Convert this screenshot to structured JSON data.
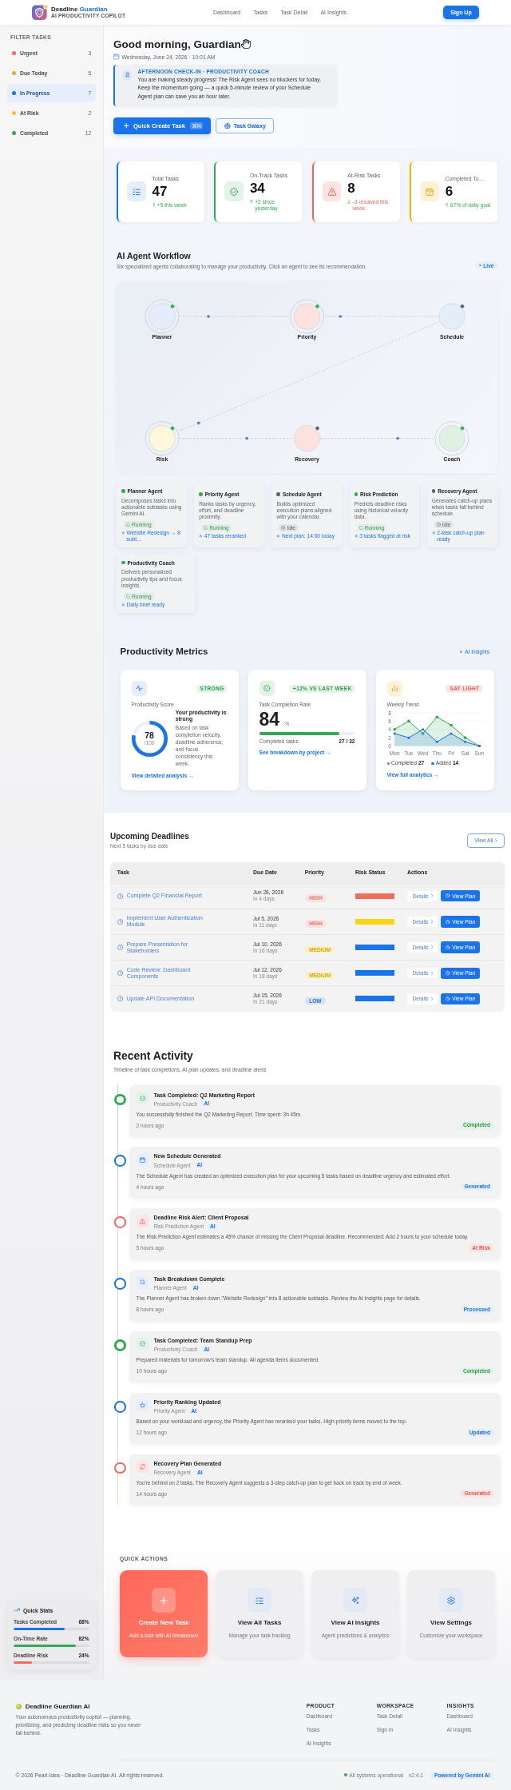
{
  "header": {
    "brand": "Deadline",
    "brand_accent": "Guardian",
    "tagline": "AI PRODUCTIVITY COPILOT",
    "nav": [
      "Dashboard",
      "Tasks",
      "Task Detail",
      "AI Insights"
    ],
    "signup": "Sign Up"
  },
  "sidebar": {
    "title": "FILTER TASKS",
    "filters": [
      {
        "label": "Urgent",
        "count": "3",
        "color": "#ef6b5e",
        "selected": false
      },
      {
        "label": "Due Today",
        "count": "5",
        "color": "#f5a524",
        "selected": false
      },
      {
        "label": "In Progress",
        "count": "7",
        "color": "#1a73e8",
        "selected": true
      },
      {
        "label": "At Risk",
        "count": "2",
        "color": "#f6c21c",
        "selected": false
      },
      {
        "label": "Completed",
        "count": "12",
        "color": "#34a853",
        "selected": false
      }
    ],
    "quick_stats": {
      "title": "Quick Stats",
      "items": [
        {
          "label": "Tasks Completed",
          "reading": "68%",
          "level": 0.68,
          "color": "#1a73e8"
        },
        {
          "label": "On-Time Rate",
          "reading": "82%",
          "level": 0.82,
          "color": "#34a853"
        },
        {
          "label": "Deadline Risk",
          "reading": "24%",
          "level": 0.24,
          "color": "#ef6b5e"
        }
      ]
    }
  },
  "greeting": {
    "title": "Good morning, Guardian",
    "date": "Wednesday, June 24, 2026 · 10:01 AM"
  },
  "coach": {
    "title": "AFTERNOON CHECK-IN · PRODUCTIVITY COACH",
    "text": "You are making steady progress! The Risk Agent sees no blockers for today. Keep the momentum going — a quick 5-minute review of your Schedule Agent plan can save you an hour later."
  },
  "hero_actions": [
    {
      "kind": "primary",
      "label": "Quick Create Task",
      "shortcut": "⌘N"
    },
    {
      "kind": "outline",
      "label": "Task Galaxy"
    }
  ],
  "stats": [
    {
      "kind": "total",
      "label": "Total Tasks",
      "value": "47",
      "trend": "+5 this week",
      "rising": true
    },
    {
      "kind": "on_track",
      "label": "On-Track Tasks",
      "value": "34",
      "trend": "+2 since yesterday",
      "rising": true
    },
    {
      "kind": "at_risk",
      "label": "At-Risk Tasks",
      "value": "8",
      "trend": "-3 resolved this week",
      "rising": false
    },
    {
      "kind": "completed",
      "label": "Completed To…",
      "value": "6",
      "trend": "67% of daily goal",
      "rising": true
    }
  ],
  "workflow": {
    "title": "AI Agent Workflow",
    "subtitle": "Six specialized agents collaborating to manage your productivity. Click an agent to see its recommendation.",
    "live": "Live",
    "nodes": [
      {
        "label": "Planner",
        "color": "#e6edfa",
        "running": true
      },
      {
        "label": "Priority",
        "color": "#fce2df",
        "running": true
      },
      {
        "label": "Schedule",
        "color": "#e6edfa",
        "running": false
      },
      {
        "label": "Risk",
        "color": "#fdf8dc",
        "running": true
      },
      {
        "label": "Recovery",
        "color": "#fce2df",
        "running": false
      },
      {
        "label": "Coach",
        "color": "#dff1e3",
        "running": true
      }
    ],
    "agents": [
      {
        "name": "Planner Agent",
        "description": "Decomposes tasks into actionable subtasks using Gemini AI.",
        "running": true,
        "status": "Running",
        "output": "Website Redesign → 8 subt…"
      },
      {
        "name": "Priority Agent",
        "description": "Ranks tasks by urgency, effort, and deadline proximity.",
        "running": true,
        "status": "Running",
        "output": "47 tasks reranked"
      },
      {
        "name": "Schedule Agent",
        "description": "Builds optimized execution plans aligned with your calendar.",
        "running": false,
        "status": "Idle",
        "output": "Next plan: 14:00 today"
      },
      {
        "name": "Risk Prediction",
        "description": "Predicts deadline risks using historical velocity data.",
        "running": true,
        "status": "Running",
        "output": "3 tasks flagged at risk"
      },
      {
        "name": "Recovery Agent",
        "description": "Generates catch-up plans when tasks fall behind schedule.",
        "running": false,
        "status": "Idle",
        "output": "2-task catch-up plan ready"
      },
      {
        "name": "Productivity Coach",
        "description": "Delivers personalized productivity tips and focus insights.",
        "running": true,
        "status": "Running",
        "output": "Daily brief ready"
      }
    ]
  },
  "metrics": {
    "title": "Productivity Metrics",
    "link": "AI Insights",
    "cards": [
      {
        "kind": "score",
        "badge": "STRONG",
        "positive": true,
        "label": "Productivity Score",
        "value": "78",
        "max": "/100",
        "level": 0.78,
        "headline": "Your productivity is strong",
        "text": "Based on task completion velocity, deadline adherence, and focus consistency this week.",
        "link": "View detailed analysis →"
      },
      {
        "kind": "rate",
        "badge": "+12% VS LAST WEEK",
        "positive": true,
        "label": "Task Completion Rate",
        "value": "84",
        "unit": "%",
        "level": 0.84,
        "caption": "Completed tasks",
        "reading": "27 / 32",
        "link": "See breakdown by project →"
      },
      {
        "kind": "trend",
        "badge": "SAT LIGHT",
        "positive": false,
        "label": "Weekly Trend",
        "chart_data": {
          "type": "area",
          "categories": [
            "Mon",
            "Tue",
            "Wed",
            "Thu",
            "Fri",
            "Sat",
            "Sun"
          ],
          "ylim": [
            0,
            8
          ],
          "yticks": [
            0,
            2,
            4,
            6,
            8
          ],
          "grid": true,
          "series": [
            {
              "name": "Completed",
              "color": "#34a853",
              "values": [
                4,
                6,
                3,
                7,
                5,
                2,
                0
              ]
            },
            {
              "name": "Added",
              "color": "#1a73e8",
              "values": [
                3,
                2,
                4,
                1,
                3,
                1,
                0
              ]
            }
          ]
        },
        "totals": [
          "27",
          "14"
        ],
        "link": "View full analytics →"
      }
    ]
  },
  "deadlines": {
    "title": "Upcoming Deadlines",
    "subtitle": "Next 5 tasks by due date",
    "view_all": "View All",
    "columns": [
      "Task",
      "Due Date",
      "Priority",
      "Risk Status",
      "Actions"
    ],
    "rows": [
      {
        "task": "Complete Q2 Financial Report",
        "due": "Jun 28, 2026",
        "relative": "In 4 days",
        "priority": {
          "label": "HIGH",
          "kind": "high"
        },
        "risk": {
          "color": "#f26b5b"
        },
        "details": "Details",
        "plan": "View Plan"
      },
      {
        "task": "Implement User Authentication Module",
        "due": "Jul 5, 2026",
        "relative": "In 11 days",
        "priority": {
          "label": "HIGH",
          "kind": "high"
        },
        "risk": {
          "color": "#fdd314"
        },
        "details": "Details",
        "plan": "View Plan"
      },
      {
        "task": "Prepare Presentation for Stakeholders",
        "due": "Jul 10, 2026",
        "relative": "In 16 days",
        "priority": {
          "label": "MEDIUM",
          "kind": "medium"
        },
        "risk": {
          "color": "#1a73e8"
        },
        "details": "Details",
        "plan": "View Plan"
      },
      {
        "task": "Code Review: Dashboard Components",
        "due": "Jul 12, 2026",
        "relative": "In 18 days",
        "priority": {
          "label": "MEDIUM",
          "kind": "medium"
        },
        "risk": {
          "color": "#1a73e8"
        },
        "details": "Details",
        "plan": "View Plan"
      },
      {
        "task": "Update API Documentation",
        "due": "Jul 15, 2026",
        "relative": "In 21 days",
        "priority": {
          "label": "LOW",
          "kind": "low"
        },
        "risk": {
          "color": "#1a73e8"
        },
        "details": "Details",
        "plan": "View Plan"
      }
    ]
  },
  "activity": {
    "title": "Recent Activity",
    "subtitle": "Timeline of task completions, AI plan updates, and deadline alerts",
    "items": [
      {
        "kind": "completed",
        "title": "Task Completed: Q2 Marketing Report",
        "agent": "Productivity Coach",
        "ai": "AI",
        "text": "You successfully finished the Q2 Marketing Report. Time spent: 3h 45m.",
        "time": "2 hours ago",
        "status": "Completed"
      },
      {
        "kind": "schedule",
        "title": "New Schedule Generated",
        "agent": "Schedule Agent",
        "ai": "AI",
        "text": "The Schedule Agent has created an optimized execution plan for your upcoming 5 tasks based on deadline urgency and estimated effort.",
        "time": "4 hours ago",
        "status": "Generated"
      },
      {
        "kind": "risk",
        "title": "Deadline Risk Alert: Client Proposal",
        "agent": "Risk Prediction Agent",
        "ai": "AI",
        "text": "The Risk Prediction Agent estimates a 45% chance of missing the Client Proposal deadline. Recommended: Add 2 hours to your schedule today.",
        "time": "5 hours ago",
        "status": "At Risk"
      },
      {
        "kind": "breakdown",
        "title": "Task Breakdown Complete",
        "agent": "Planner Agent",
        "ai": "AI",
        "text": "The Planner Agent has broken down \"Website Redesign\" into 8 actionable subtasks. Review the AI Insights page for details.",
        "time": "8 hours ago",
        "status": "Processed"
      },
      {
        "kind": "completed",
        "title": "Task Completed: Team Standup Prep",
        "agent": "Productivity Coach",
        "ai": "AI",
        "text": "Prepared materials for tomorrow's team standup. All agenda items documented.",
        "time": "10 hours ago",
        "status": "Completed"
      },
      {
        "kind": "priority",
        "title": "Priority Ranking Updated",
        "agent": "Priority Agent",
        "ai": "AI",
        "text": "Based on your workload and urgency, the Priority Agent has reranked your tasks. High-priority items moved to the top.",
        "time": "12 hours ago",
        "status": "Updated"
      },
      {
        "kind": "recovery",
        "title": "Recovery Plan Generated",
        "agent": "Recovery Agent",
        "ai": "AI",
        "text": "You're behind on 2 tasks. The Recovery Agent suggests a 3-step catch-up plan to get back on track by end of week.",
        "time": "14 hours ago",
        "status": "Generated"
      }
    ]
  },
  "quick_actions": {
    "title": "QUICK ACTIONS",
    "items": [
      {
        "kind": "create",
        "title": "Create New Task",
        "text": "Add a task with AI breakdown"
      },
      {
        "kind": "tasks",
        "title": "View All Tasks",
        "text": "Manage your task backlog"
      },
      {
        "kind": "insights",
        "title": "View AI Insights",
        "text": "Agent predictions & analytics"
      },
      {
        "kind": "settings",
        "title": "View Settings",
        "text": "Customize your workspace"
      }
    ]
  },
  "footer": {
    "brand": "Deadline Guardian AI",
    "text": "Your autonomous productivity copilot — planning, prioritizing, and predicting deadline risks so you never fall behind.",
    "columns": [
      {
        "title": "PRODUCT",
        "links": [
          "Dashboard",
          "Tasks",
          "AI Insights"
        ]
      },
      {
        "title": "WORKSPACE",
        "links": [
          "Task Detail",
          "Sign In"
        ]
      },
      {
        "title": "INSIGHTS",
        "links": [
          "Dashboard",
          "AI Insights"
        ]
      }
    ],
    "copyright": "© 2026 Pearl-Idea · Deadline Guardian AI. All rights reserved.",
    "status": "All systems operational",
    "version": "v2.4.1",
    "powered": "Powered by Gemini AI"
  }
}
